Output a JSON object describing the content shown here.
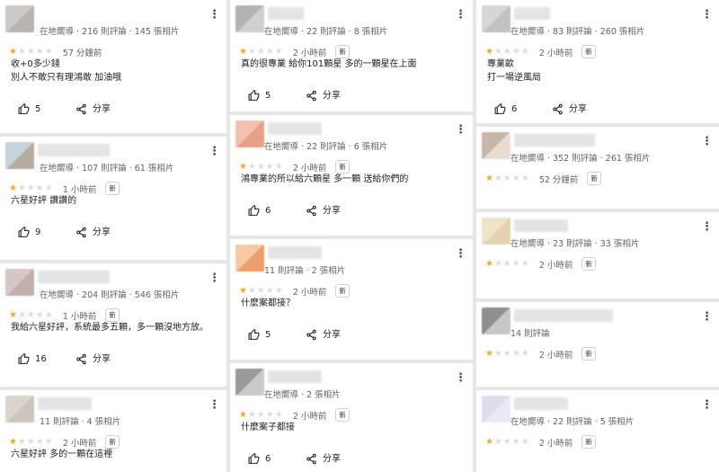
{
  "strings": {
    "new": "新",
    "share": "分享"
  },
  "reviews": [
    {
      "meta": "在地嚮導 · 216 則評論 · 145 張相片",
      "time": "57 分鐘前",
      "new": false,
      "lines": [
        "收+0多少錢",
        "別人不敢只有理鴻敢 加油哦"
      ],
      "likes": "5"
    },
    {
      "meta": "在地嚮導 · 107 則評論 · 61 張相片",
      "time": "1 小時前",
      "new": true,
      "lines": [
        "六星好評 讚讚的"
      ],
      "likes": "9"
    },
    {
      "meta": "在地嚮導 · 204 則評論 · 546 張相片",
      "time": "1 小時前",
      "new": true,
      "lines": [
        "我給六星好評，系統最多五顆，多一顆沒地方放。"
      ],
      "likes": "16"
    },
    {
      "meta": "11 則評論 · 4 張相片",
      "time": "2 小時前",
      "new": true,
      "lines": [
        "六星好評 多的一顆在這裡"
      ],
      "likes": ""
    },
    {
      "meta": "在地嚮導 · 22 則評論 · 8 張相片",
      "time": "2 小時前",
      "new": true,
      "lines": [
        "真的很專業 給你101顆星 多的一顆星在上面"
      ],
      "likes": "5"
    },
    {
      "meta": "在地嚮導 · 22 則評論 · 6 張相片",
      "time": "2 小時前",
      "new": true,
      "lines": [
        "鴻專業的所以給六顆星 多一顆 送給你們的"
      ],
      "likes": "6"
    },
    {
      "meta": "11 則評論 · 2 張相片",
      "time": "2 小時前",
      "new": true,
      "lines": [
        "什麼案都接？"
      ],
      "likes": "5"
    },
    {
      "meta": "在地嚮導 · 2 張相片",
      "time": "2 小時前",
      "new": true,
      "lines": [
        "什麼案子都接"
      ],
      "likes": "6"
    },
    {
      "meta": "在地嚮導 · 83 則評論 · 260 張相片",
      "time": "2 小時前",
      "new": true,
      "lines": [
        "專業歐",
        "打一場逆風局"
      ],
      "likes": "6"
    },
    {
      "meta": "在地嚮導 · 352 則評論 · 261 張相片",
      "time": "52 分鐘前",
      "new": true,
      "lines": [],
      "likes": ""
    },
    {
      "meta": "在地嚮導 · 23 則評論 · 33 張相片",
      "time": "2 小時前",
      "new": true,
      "lines": [],
      "likes": ""
    },
    {
      "meta": "14 則評論",
      "time": "2 小時前",
      "new": true,
      "lines": [],
      "likes": ""
    },
    {
      "meta": "在地嚮導 · 22 則評論 · 5 張相片",
      "time": "2 小時前",
      "new": true,
      "lines": [],
      "likes": ""
    }
  ],
  "colors": {
    "star_on": "#f5a623",
    "star_off": "#dcdcdc",
    "card": "#ffffff",
    "gap": "#e6e6e6"
  }
}
